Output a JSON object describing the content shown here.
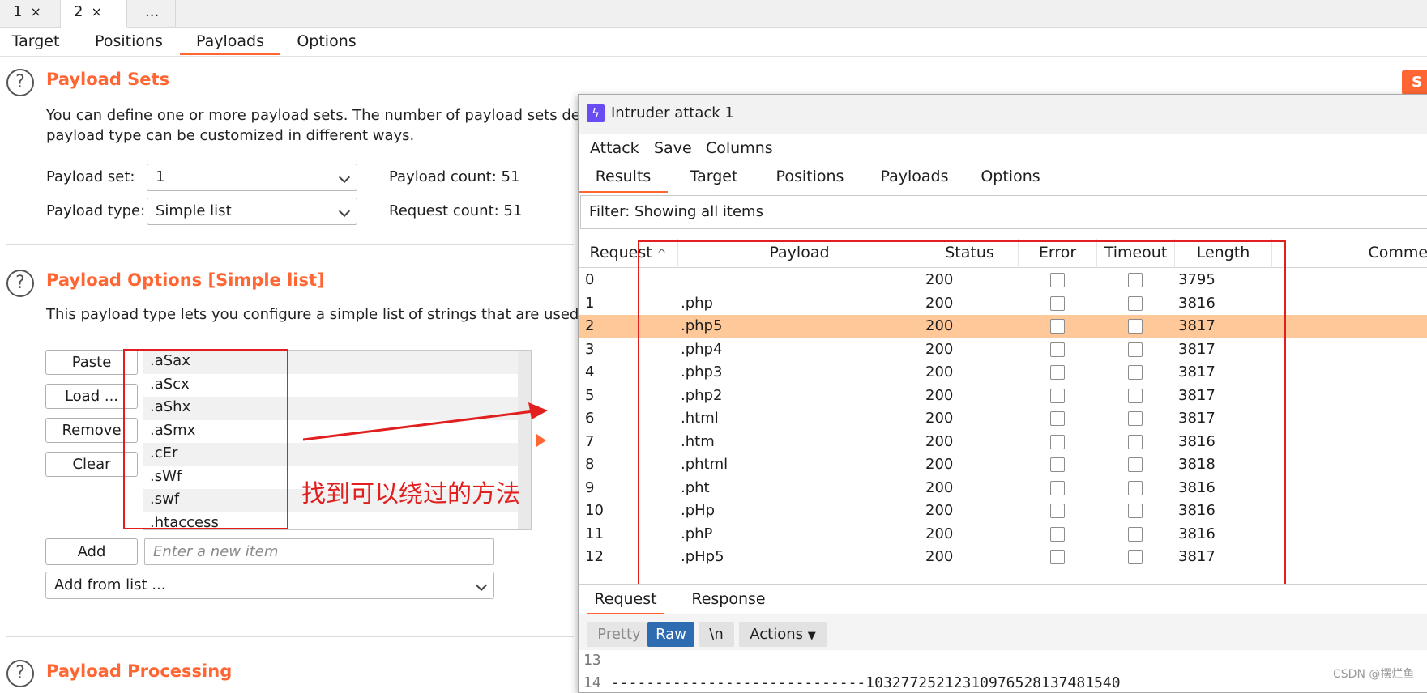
{
  "attack_tabs": [
    {
      "label": "1",
      "close": "×"
    },
    {
      "label": "2",
      "close": "×"
    },
    {
      "label": "..."
    }
  ],
  "sub_tabs": [
    "Target",
    "Positions",
    "Payloads",
    "Options"
  ],
  "payload_sets": {
    "title": "Payload Sets",
    "desc_line1": "You can define one or more payload sets. The number of payload sets depen",
    "desc_line2": "payload type can be customized in different ways.",
    "set_label": "Payload set:",
    "set_value": "1",
    "type_label": "Payload type:",
    "type_value": "Simple list",
    "payload_count_label": "Payload count:",
    "payload_count": "51",
    "request_count_label": "Request count:",
    "request_count": "51"
  },
  "payload_options": {
    "title": "Payload Options [Simple list]",
    "desc": "This payload type lets you configure a simple list of strings that are used as p",
    "buttons": [
      "Paste",
      "Load ...",
      "Remove",
      "Clear"
    ],
    "items": [
      ".aSax",
      ".aScx",
      ".aShx",
      ".aSmx",
      ".cEr",
      ".sWf",
      ".swf",
      ".htaccess"
    ],
    "add_button": "Add",
    "add_placeholder": "Enter a new item",
    "add_from_list": "Add from list ..."
  },
  "annotation": "找到可以绕过的方法",
  "payload_processing": {
    "title": "Payload Processing"
  },
  "orange_button": "S",
  "intruder": {
    "title": "Intruder attack 1",
    "menu": [
      "Attack",
      "Save",
      "Columns"
    ],
    "tabs": [
      "Results",
      "Target",
      "Positions",
      "Payloads",
      "Options"
    ],
    "filter": "Filter: Showing all items",
    "columns": [
      "Request",
      "Payload",
      "Status",
      "Error",
      "Timeout",
      "Length",
      "Comment"
    ],
    "sort_icon": "^",
    "rows": [
      [
        "0",
        "",
        "200",
        "3795"
      ],
      [
        "1",
        ".php",
        "200",
        "3816"
      ],
      [
        "2",
        ".php5",
        "200",
        "3817"
      ],
      [
        "3",
        ".php4",
        "200",
        "3817"
      ],
      [
        "4",
        ".php3",
        "200",
        "3817"
      ],
      [
        "5",
        ".php2",
        "200",
        "3817"
      ],
      [
        "6",
        ".html",
        "200",
        "3817"
      ],
      [
        "7",
        ".htm",
        "200",
        "3816"
      ],
      [
        "8",
        ".phtml",
        "200",
        "3818"
      ],
      [
        "9",
        ".pht",
        "200",
        "3816"
      ],
      [
        "10",
        ".pHp",
        "200",
        "3816"
      ],
      [
        "11",
        ".phP",
        "200",
        "3816"
      ],
      [
        "12",
        ".pHp5",
        "200",
        "3817"
      ]
    ],
    "selected_row": 2,
    "bottom_tabs": [
      "Request",
      "Response"
    ],
    "view_buttons": [
      "Pretty",
      "Raw",
      "\\n",
      "Actions"
    ],
    "code_line_13": "13",
    "code_line_14": "14",
    "code_text_14": "-----------------------------10327725212310976528137481540"
  },
  "watermark": "CSDN @摆烂鱼",
  "colors": {
    "accent": "#ff6633",
    "red_annotation": "#e21f1f",
    "selected_row": "#ffc899",
    "raw_active": "#2d6cb0"
  }
}
